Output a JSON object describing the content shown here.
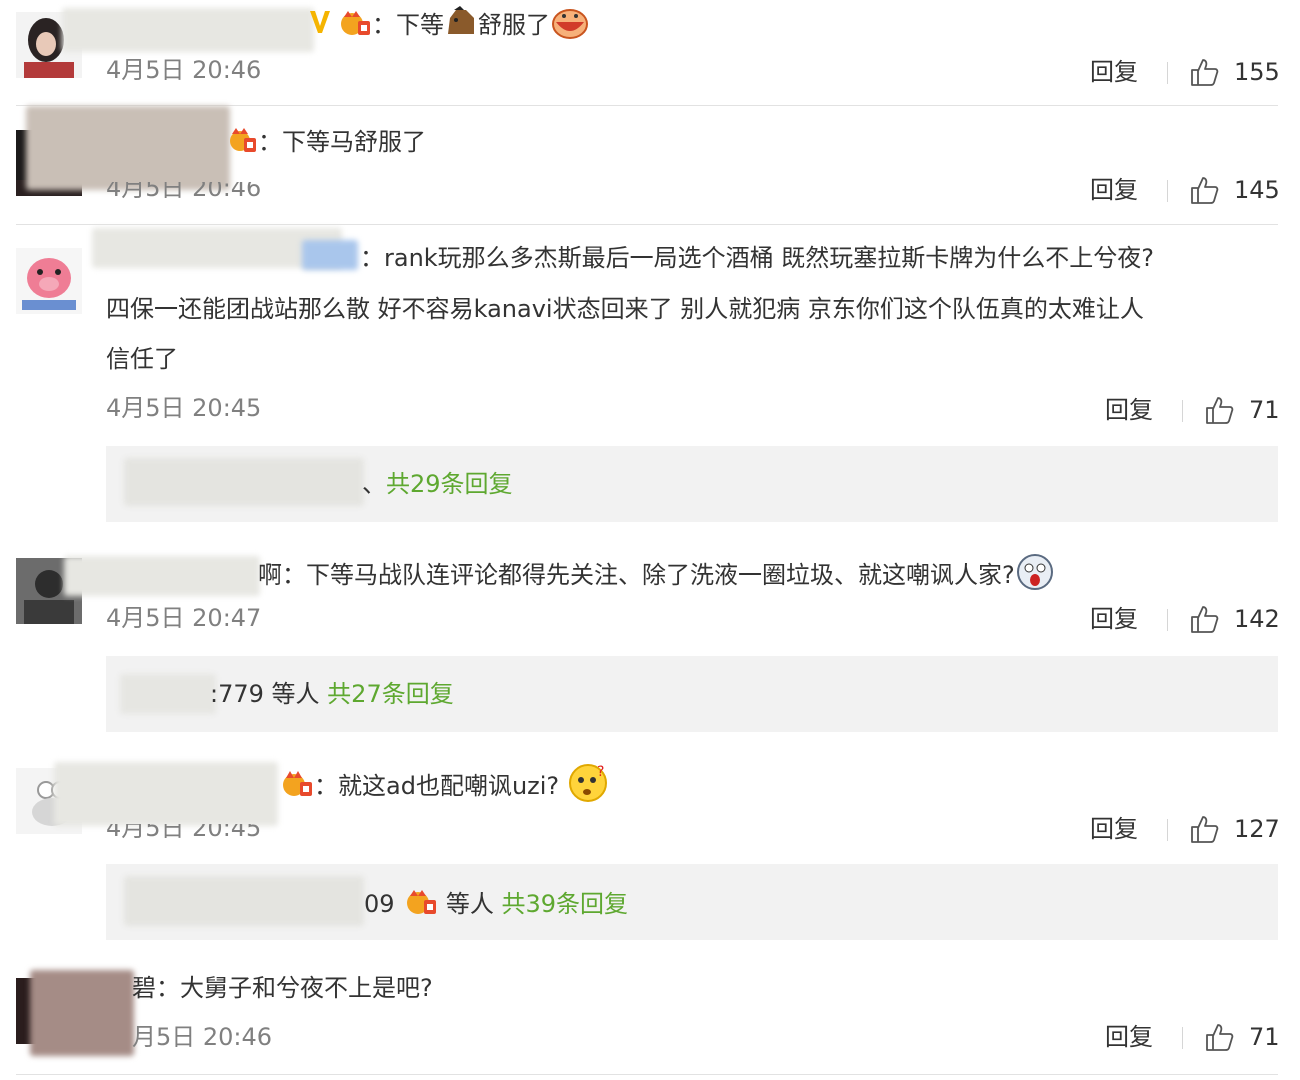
{
  "comments": [
    {
      "text": "：下等",
      "text_tail": "舒服了",
      "time": "4月5日 20:46",
      "reply_label": "回复",
      "likes": "155"
    },
    {
      "text": "：下等马舒服了",
      "time": "4月5日 20:46",
      "reply_label": "回复",
      "likes": "145"
    },
    {
      "line1": "：rank玩那么多杰斯最后一局选个酒桶 既然玩塞拉斯卡牌为什么不上兮夜?",
      "line2": "四保一还能团战站那么散 好不容易kanavi状态回来了 别人就犯病 京东你们这个队伍真的太难让人",
      "line3": "信任了",
      "time": "4月5日 20:45",
      "reply_label": "回复",
      "likes": "71",
      "replies_summary": "共29条回复"
    },
    {
      "text": "啊：下等马战队连评论都得先关注、除了洗液一圈垃圾、就这嘲讽人家?",
      "time": "4月5日 20:47",
      "reply_label": "回复",
      "likes": "142",
      "replies_user": ":779 等人",
      "replies_summary": "共27条回复"
    },
    {
      "text": "：就这ad也配嘲讽uzi?",
      "time": "4月5日 20:45",
      "reply_label": "回复",
      "likes": "127",
      "replies_user": "09",
      "replies_user2": "等人",
      "replies_summary": "共39条回复"
    },
    {
      "text": "碧：大舅子和兮夜不上是吧?",
      "time": "月5日 20:46",
      "reply_label": "回复",
      "likes": "71"
    }
  ],
  "icons": {
    "like": "thumbs-up-icon",
    "vip": "vip-crown-icon",
    "horse": "horse-emoji-icon",
    "drool": "drool-emoji-icon",
    "shocked": "shocked-emoji-icon",
    "question": "question-emoji-icon"
  },
  "colors": {
    "link_green": "#5ea830",
    "time_gray": "#808080",
    "reply_bg": "#f2f2f2",
    "divider": "#e2e2e2"
  }
}
